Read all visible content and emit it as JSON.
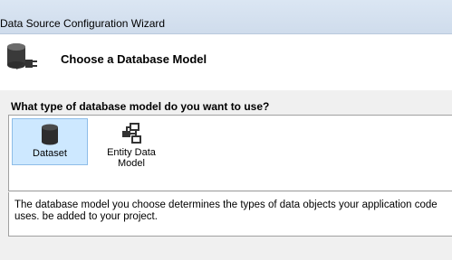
{
  "window": {
    "title": "Data Source Configuration Wizard"
  },
  "header": {
    "heading": "Choose a Database Model",
    "icon": "database-plug-icon"
  },
  "question": "What type of database model do you want to use?",
  "models": [
    {
      "label": "Dataset",
      "icon": "database-icon",
      "selected": true
    },
    {
      "label": "Entity Data Model",
      "icon": "entity-data-model-icon",
      "selected": false
    }
  ],
  "description": "The database model you choose determines the types of data objects your application code uses. be added to your project.",
  "colors": {
    "selection": "#cde8ff",
    "selection_border": "#8ebde8"
  }
}
